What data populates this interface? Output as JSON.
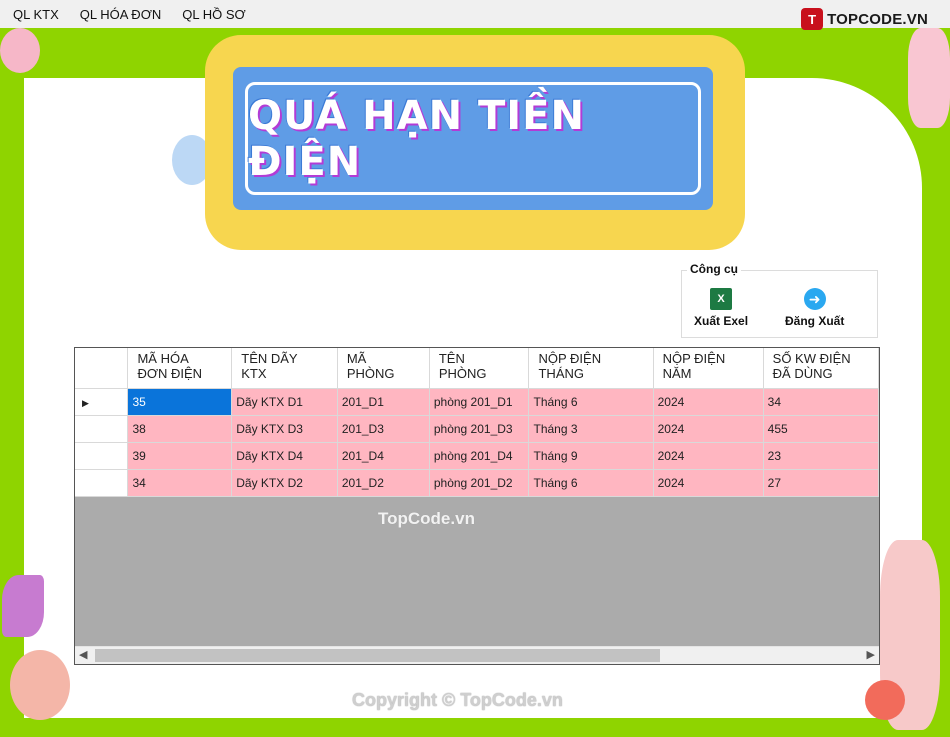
{
  "menu": [
    "QL KTX",
    "QL HÓA ĐƠN",
    "QL HỒ SƠ"
  ],
  "brand": {
    "logo": "T",
    "text": "TOPCODE.VN"
  },
  "banner": {
    "title": "QUÁ HẠN TIỀN ĐIỆN"
  },
  "toolbar": {
    "group_label": "Công cụ",
    "export_label": "Xuất Exel",
    "export_icon": "excel-icon",
    "logout_label": "Đăng Xuất",
    "logout_icon": "logout-arrow-icon"
  },
  "grid": {
    "columns": [
      "MÃ HÓA\nĐƠN ĐIỆN",
      "TÊN DÃY\nKTX",
      "MÃ\nPHÒNG",
      "TÊN\nPHÒNG",
      "NỘP ĐIỆN\nTHÁNG",
      "NỘP ĐIỆN\nNĂM",
      "SỐ KW ĐIỆN\nĐÃ DÙNG"
    ],
    "rows": [
      [
        "35",
        "Dãy KTX D1",
        "201_D1",
        "phòng 201_D1",
        "Tháng 6",
        "2024",
        "34"
      ],
      [
        "38",
        "Dãy KTX D3",
        "201_D3",
        "phòng 201_D3",
        "Tháng 3",
        "2024",
        "455"
      ],
      [
        "39",
        "Dãy KTX D4",
        "201_D4",
        "phòng 201_D4",
        "Tháng 9",
        "2024",
        "23"
      ],
      [
        "34",
        "Dãy KTX D2",
        "201_D2",
        "phòng 201_D2",
        "Tháng 6",
        "2024",
        "27"
      ]
    ],
    "current_row_marker": "▶",
    "selected_cell_color": "#0a74da",
    "row_color": "#ffb6c1"
  },
  "watermark": "TopCode.vn",
  "copyright": "Copyright © TopCode.vn",
  "colors": {
    "frame": "#8fd400",
    "banner_blue": "#5f9ce6",
    "banner_yellow": "#f7d64f"
  }
}
